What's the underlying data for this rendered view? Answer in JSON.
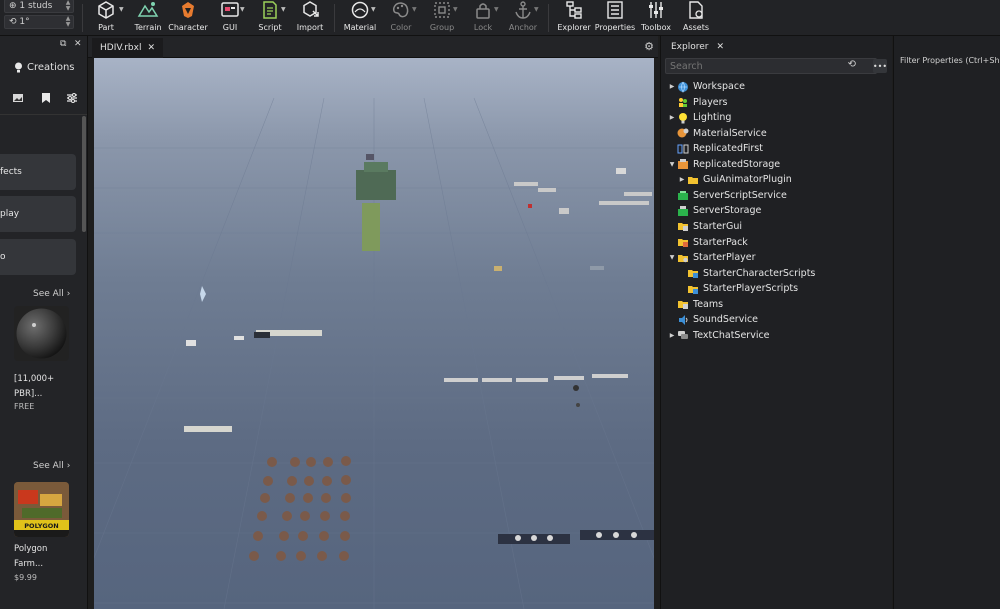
{
  "ribbon": {
    "grid_step": "1 studs",
    "rotate_step": "1°",
    "tools": [
      {
        "label": "Part",
        "icon": "part-icon"
      },
      {
        "label": "Terrain",
        "icon": "terrain-icon"
      },
      {
        "label": "Character",
        "icon": "character-icon"
      },
      {
        "label": "GUI",
        "icon": "gui-icon"
      },
      {
        "label": "Script",
        "icon": "script-icon"
      },
      {
        "label": "Import",
        "icon": "import-icon"
      },
      {
        "label": "Material",
        "icon": "material-icon"
      },
      {
        "label": "Color",
        "icon": "color-icon"
      },
      {
        "label": "Group",
        "icon": "group-icon"
      },
      {
        "label": "Lock",
        "icon": "lock-icon"
      },
      {
        "label": "Anchor",
        "icon": "anchor-icon"
      },
      {
        "label": "Explorer",
        "icon": "explorer-icon"
      },
      {
        "label": "Properties",
        "icon": "properties-icon"
      },
      {
        "label": "Toolbox",
        "icon": "toolbox-icon"
      },
      {
        "label": "Assets",
        "icon": "assets-icon"
      }
    ]
  },
  "left_panel": {
    "title": "Creations",
    "categories": [
      "fects",
      "play",
      "o"
    ],
    "see_all_1": "See All",
    "see_all_2": "See All",
    "asset1": {
      "name_line1": "[11,000+",
      "name_line2": "PBR]...",
      "price": "FREE"
    },
    "asset2": {
      "name_line1": "Polygon",
      "name_line2": "Farm...",
      "price": "$9.99",
      "banner": "POLYGON"
    }
  },
  "viewport": {
    "tab_label": "HDIV.rbxl",
    "colors": {
      "sky_top": "#a8b3c6",
      "floor": "#56657e"
    }
  },
  "explorer": {
    "tab_label": "Explorer",
    "search_placeholder": "Search",
    "items": [
      {
        "label": "Workspace",
        "icon": "workspace-icon",
        "expandable": true
      },
      {
        "label": "Players",
        "icon": "players-icon",
        "expandable": false
      },
      {
        "label": "Lighting",
        "icon": "lighting-icon",
        "expandable": true
      },
      {
        "label": "MaterialService",
        "icon": "material-service-icon",
        "expandable": false
      },
      {
        "label": "ReplicatedFirst",
        "icon": "replicated-first-icon",
        "expandable": false
      },
      {
        "label": "ReplicatedStorage",
        "icon": "replicated-storage-icon",
        "expandable": true,
        "expanded": true
      },
      {
        "label": "GuiAnimatorPlugin",
        "icon": "folder-icon",
        "expandable": true,
        "indent": 1
      },
      {
        "label": "ServerScriptService",
        "icon": "server-script-service-icon",
        "expandable": false
      },
      {
        "label": "ServerStorage",
        "icon": "server-storage-icon",
        "expandable": false
      },
      {
        "label": "StarterGui",
        "icon": "starter-gui-icon",
        "expandable": false
      },
      {
        "label": "StarterPack",
        "icon": "starter-pack-icon",
        "expandable": false
      },
      {
        "label": "StarterPlayer",
        "icon": "starter-player-icon",
        "expandable": true,
        "expanded": true
      },
      {
        "label": "StarterCharacterScripts",
        "icon": "starter-character-scripts-icon",
        "expandable": false,
        "indent": 1
      },
      {
        "label": "StarterPlayerScripts",
        "icon": "starter-player-scripts-icon",
        "expandable": false,
        "indent": 1
      },
      {
        "label": "Teams",
        "icon": "teams-icon",
        "expandable": false
      },
      {
        "label": "SoundService",
        "icon": "sound-service-icon",
        "expandable": false
      },
      {
        "label": "TextChatService",
        "icon": "text-chat-service-icon",
        "expandable": true
      }
    ]
  },
  "properties": {
    "filter_placeholder": "Filter Properties (Ctrl+Shi"
  }
}
